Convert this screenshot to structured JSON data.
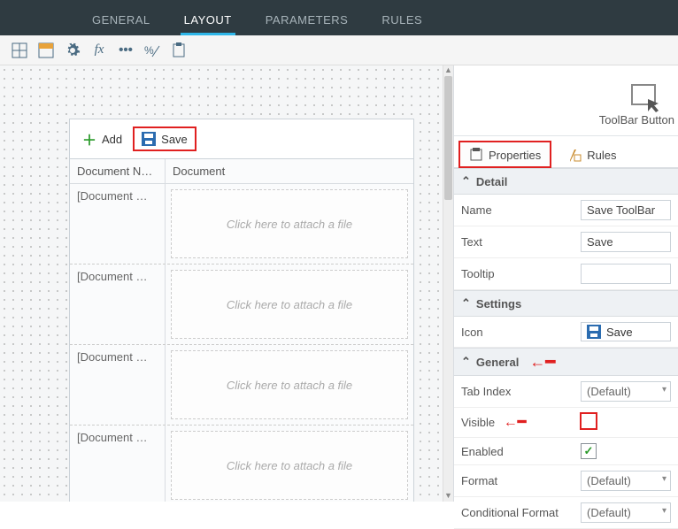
{
  "nav": {
    "tabs": [
      "GENERAL",
      "LAYOUT",
      "PARAMETERS",
      "RULES"
    ],
    "active": "LAYOUT"
  },
  "toolbar_icons": [
    "grid-icon",
    "grid-accent-icon",
    "gear-icon",
    "fx-icon",
    "ellipsis-icon",
    "percent-icon",
    "paste-icon"
  ],
  "workbench": {
    "buttons": {
      "add": "Add",
      "save": "Save"
    },
    "columns": [
      "Document N…",
      "Document"
    ],
    "rowLabel": "[Document …",
    "attachPlaceholder": "Click here to attach a file",
    "rowCount": 4
  },
  "element": {
    "type": "ToolBar Button"
  },
  "propTabs": {
    "properties": "Properties",
    "rules": "Rules"
  },
  "sections": {
    "detail": {
      "title": "Detail",
      "fields": {
        "name": {
          "label": "Name",
          "value": "Save ToolBar"
        },
        "text": {
          "label": "Text",
          "value": "Save"
        },
        "tooltip": {
          "label": "Tooltip",
          "value": ""
        }
      }
    },
    "settings": {
      "title": "Settings",
      "fields": {
        "icon": {
          "label": "Icon",
          "value": "Save"
        }
      }
    },
    "general": {
      "title": "General",
      "fields": {
        "tabIndex": {
          "label": "Tab Index",
          "value": "(Default)"
        },
        "visible": {
          "label": "Visible",
          "checked": false
        },
        "enabled": {
          "label": "Enabled",
          "checked": true
        },
        "format": {
          "label": "Format",
          "value": "(Default)"
        },
        "conditionalFormat": {
          "label": "Conditional Format",
          "value": "(Default)"
        }
      }
    }
  },
  "annotations": {
    "highlightSave": true,
    "highlightPropertiesTab": true,
    "arrowGeneral": true,
    "arrowVisible": true,
    "highlightVisibleCheckbox": true
  }
}
